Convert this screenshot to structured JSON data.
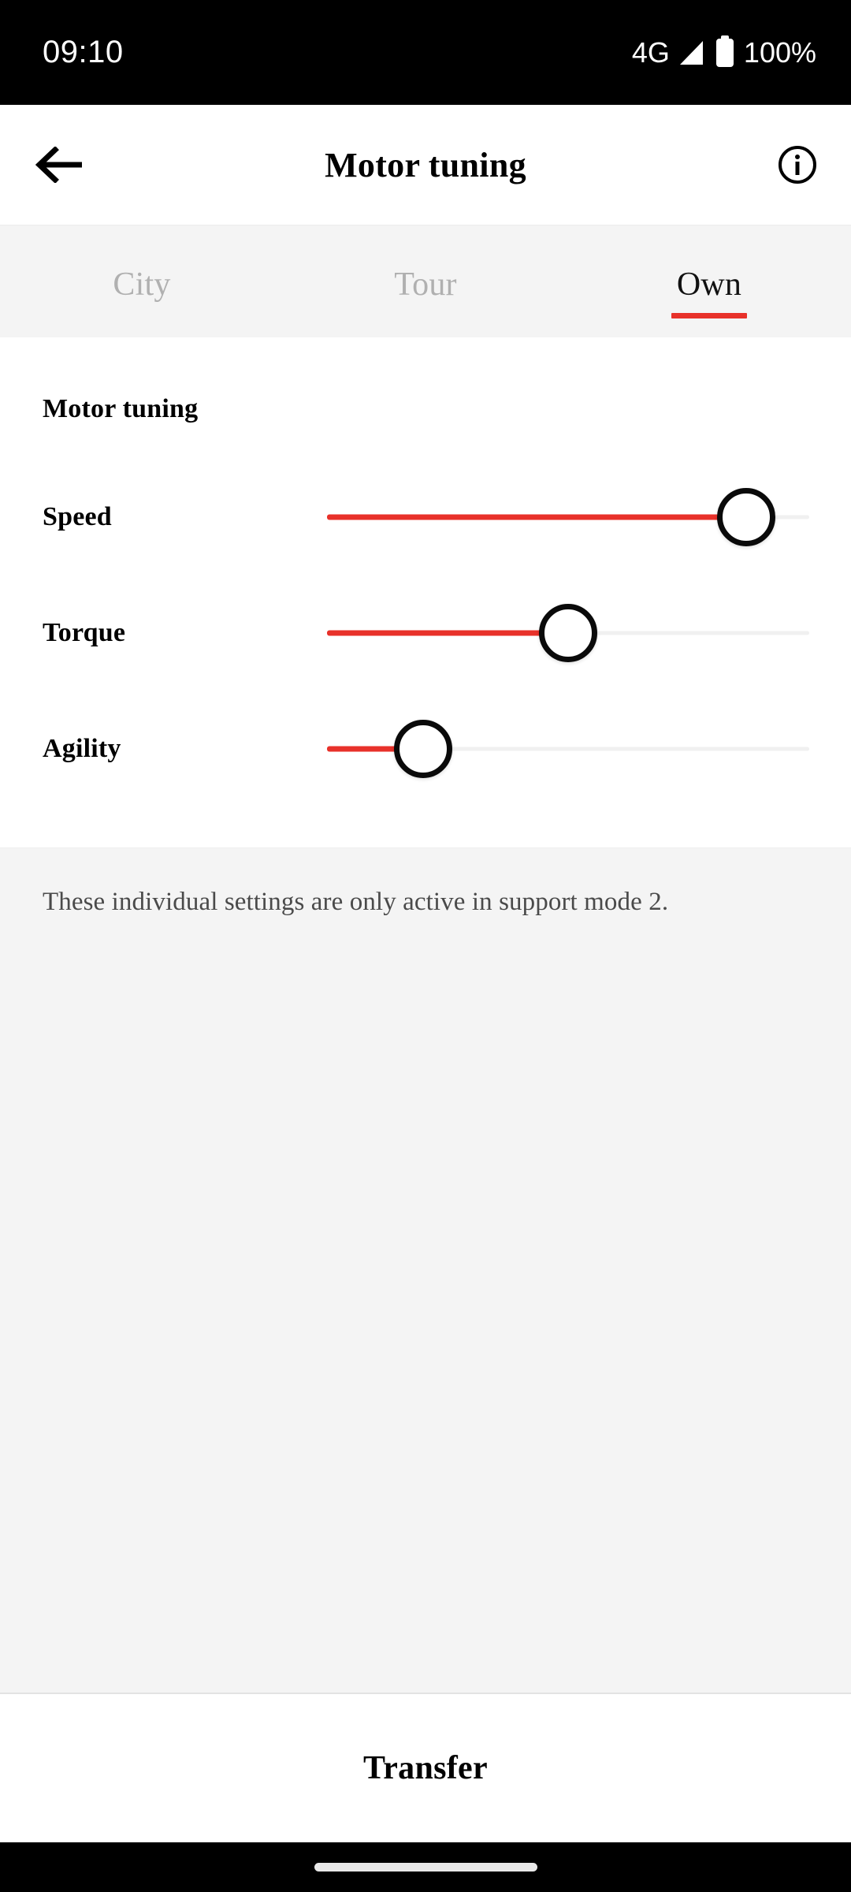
{
  "status_bar": {
    "time": "09:10",
    "network": "4G",
    "signal_icon": "signal-triangle-icon",
    "battery_icon": "battery-full-icon",
    "battery_percent": "100%"
  },
  "app_bar": {
    "back_icon": "arrow-left-icon",
    "title": "Motor tuning",
    "info_icon": "info-circle-icon"
  },
  "tabs": [
    {
      "label": "City",
      "active": false
    },
    {
      "label": "Tour",
      "active": false
    },
    {
      "label": "Own",
      "active": true
    }
  ],
  "main": {
    "section_title": "Motor tuning",
    "sliders": [
      {
        "label": "Speed",
        "value": 87
      },
      {
        "label": "Torque",
        "value": 50
      },
      {
        "label": "Agility",
        "value": 20
      }
    ],
    "note": "These individual settings are only active in support mode 2."
  },
  "footer": {
    "action_label": "Transfer"
  },
  "nav_bar": {
    "gesture_pill": "home-gesture-pill"
  },
  "colors": {
    "accent": "#e8312a",
    "tab_bar_bg": "#f4f4f4",
    "note_bg": "#f4f4f4",
    "text_primary": "#000000",
    "text_muted": "#b0b0b0",
    "track": "#f0f0f0"
  }
}
